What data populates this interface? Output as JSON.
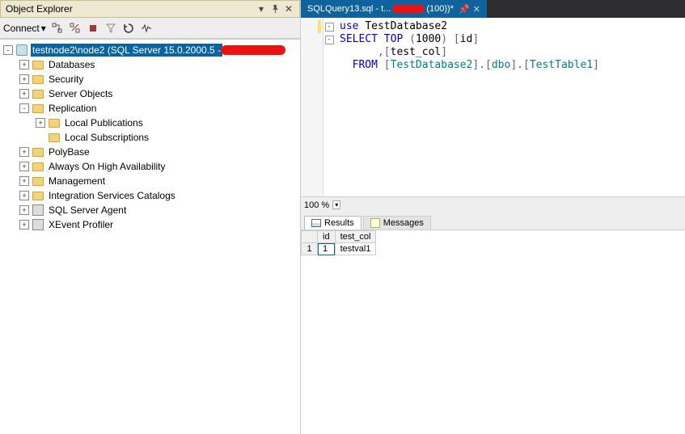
{
  "explorer": {
    "title": "Object Explorer",
    "connect_label": "Connect",
    "root": {
      "label": "testnode2\\node2 (SQL Server 15.0.2000.5 - ",
      "nodes": [
        {
          "label": "Databases",
          "expand": "+",
          "icon": "folder"
        },
        {
          "label": "Security",
          "expand": "+",
          "icon": "folder"
        },
        {
          "label": "Server Objects",
          "expand": "+",
          "icon": "folder"
        },
        {
          "label": "Replication",
          "expand": "-",
          "icon": "folder",
          "children": [
            {
              "label": "Local Publications",
              "expand": "+",
              "icon": "folder"
            },
            {
              "label": "Local Subscriptions",
              "expand": "",
              "icon": "folder"
            }
          ]
        },
        {
          "label": "PolyBase",
          "expand": "+",
          "icon": "folder"
        },
        {
          "label": "Always On High Availability",
          "expand": "+",
          "icon": "folder"
        },
        {
          "label": "Management",
          "expand": "+",
          "icon": "folder"
        },
        {
          "label": "Integration Services Catalogs",
          "expand": "+",
          "icon": "folder"
        },
        {
          "label": "SQL Server Agent",
          "expand": "+",
          "icon": "agent"
        },
        {
          "label": "XEvent Profiler",
          "expand": "+",
          "icon": "agent"
        }
      ]
    }
  },
  "tab": {
    "prefix": "SQLQuery13.sql - t...",
    "suffix": "(100))*"
  },
  "code": {
    "l1_use": "use",
    "l1_db": "TestDatabase2",
    "l2_select": "SELECT",
    "l2_top": "TOP",
    "l2_num": "1000",
    "l2_col": "id",
    "l3_col": "test_col",
    "l4_from": "FROM",
    "l4_d1": "TestDatabase2",
    "l4_d2": "dbo",
    "l4_d3": "TestTable1"
  },
  "zoom": {
    "value": "100 %"
  },
  "results": {
    "tab_results": "Results",
    "tab_messages": "Messages",
    "columns": [
      "id",
      "test_col"
    ],
    "rows": [
      {
        "n": "1",
        "id": "1",
        "test_col": "testval1"
      }
    ]
  }
}
